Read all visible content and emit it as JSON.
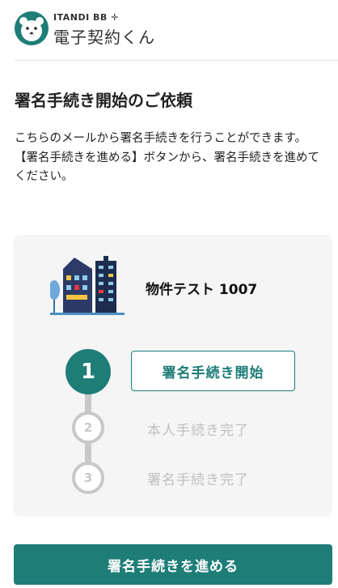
{
  "header": {
    "brand_top": "ITANDI BB ✛",
    "brand_name": "電子契約くん",
    "logo_icon": "polar-bear-icon"
  },
  "main": {
    "title": "署名手続き開始のご依頼",
    "description_line1": "こちらのメールから署名手続きを行うことができます。",
    "description_line2": "【署名手続きを進める】ボタンから、署名手続きを進めてください。"
  },
  "property": {
    "name": "物件テスト 1007",
    "icon": "building-icon"
  },
  "steps": [
    {
      "number": "1",
      "label": "署名手続き開始",
      "state": "active"
    },
    {
      "number": "2",
      "label": "本人手続き完了",
      "state": "inactive"
    },
    {
      "number": "3",
      "label": "署名手続き完了",
      "state": "inactive"
    }
  ],
  "cta": {
    "label": "署名手続きを進める"
  },
  "colors": {
    "accent": "#1f7d78",
    "inactive": "#c8c8c8",
    "card_bg": "#f5f5f5"
  }
}
